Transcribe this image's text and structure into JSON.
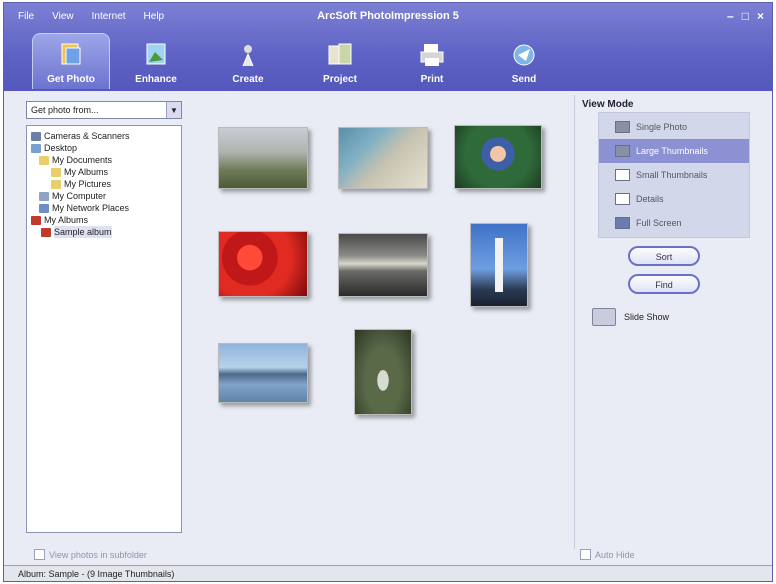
{
  "window": {
    "title": "ArcSoft PhotoImpression 5",
    "controls": [
      "–",
      "□",
      "×"
    ]
  },
  "menu": [
    "File",
    "View",
    "Internet",
    "Help"
  ],
  "toolbar": [
    {
      "label": "Get Photo",
      "icon": "get-photo-icon",
      "active": true
    },
    {
      "label": "Enhance",
      "icon": "enhance-icon",
      "active": false
    },
    {
      "label": "Create",
      "icon": "create-icon",
      "active": false
    },
    {
      "label": "Project",
      "icon": "project-icon",
      "active": false
    },
    {
      "label": "Print",
      "icon": "print-icon",
      "active": false
    },
    {
      "label": "Send",
      "icon": "send-icon",
      "active": false
    }
  ],
  "left": {
    "combo": "Get photo from...",
    "tree": [
      {
        "label": "Cameras & Scanners",
        "icon": "camera-icon"
      },
      {
        "label": "Desktop",
        "icon": "desktop-icon"
      },
      {
        "label": "My Documents",
        "icon": "folder-icon"
      },
      {
        "label": "My Albums",
        "icon": "folder-icon"
      },
      {
        "label": "My Pictures",
        "icon": "folder-icon"
      },
      {
        "label": "My Computer",
        "icon": "computer-icon"
      },
      {
        "label": "My Network Places",
        "icon": "network-icon"
      },
      {
        "label": "My Albums",
        "icon": "album-icon"
      },
      {
        "label": "Sample album",
        "icon": "album-icon"
      }
    ],
    "footer": "View photos in subfolder"
  },
  "right": {
    "view_mode_title": "View Mode",
    "view_modes": [
      {
        "label": "Single Photo",
        "selected": false
      },
      {
        "label": "Large Thumbnails",
        "selected": true
      },
      {
        "label": "Small Thumbnails",
        "selected": false
      },
      {
        "label": "Details",
        "selected": false
      },
      {
        "label": "Full Screen",
        "selected": false
      }
    ],
    "sort": "Sort",
    "find": "Find",
    "slide_show": "Slide Show",
    "autohide": "Auto Hide"
  },
  "status": "Album: Sample - (9 Image Thumbnails)",
  "colors": {
    "accent": "#5e62c4",
    "selection": "#8c91d3"
  }
}
